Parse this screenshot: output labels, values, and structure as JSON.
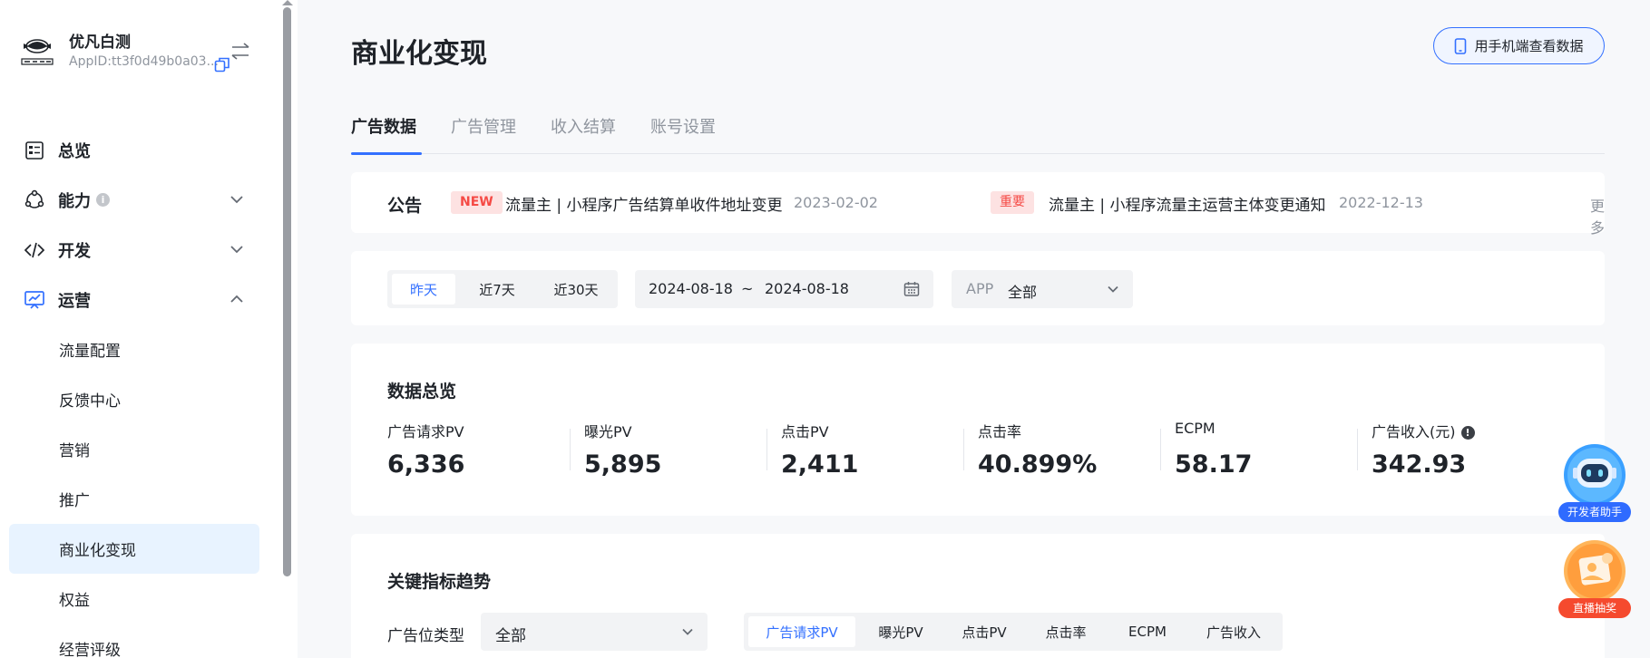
{
  "app": {
    "name": "优凡白测",
    "app_id": "AppID:tt3f0d49b0a03..."
  },
  "nav": {
    "items": [
      {
        "label": "总览",
        "icon": "overview-icon"
      },
      {
        "label": "能力",
        "icon": "ability-icon",
        "has_info": true,
        "info_glyph": "i"
      },
      {
        "label": "开发",
        "icon": "code-icon"
      },
      {
        "label": "运营",
        "icon": "operation-icon"
      }
    ],
    "sub_items": [
      {
        "label": "流量配置"
      },
      {
        "label": "反馈中心"
      },
      {
        "label": "营销"
      },
      {
        "label": "推广"
      },
      {
        "label": "商业化变现",
        "selected": true
      },
      {
        "label": "权益"
      },
      {
        "label": "经营评级"
      }
    ]
  },
  "page": {
    "title": "商业化变现",
    "mobile_button": "用手机端查看数据"
  },
  "tabs": [
    {
      "label": "广告数据",
      "active": true
    },
    {
      "label": "广告管理"
    },
    {
      "label": "收入结算"
    },
    {
      "label": "账号设置"
    }
  ],
  "notice": {
    "title": "公告",
    "items": [
      {
        "badge": "NEW",
        "text": "流量主 | 小程序广告结算单收件地址变更",
        "date": "2023-02-02"
      },
      {
        "badge": "重要",
        "text": "流量主 | 小程序流量主运营主体变更通知",
        "date": "2022-12-13"
      }
    ],
    "more": "更多"
  },
  "filter": {
    "range_options": [
      {
        "label": "昨天",
        "active": true
      },
      {
        "label": "近7天"
      },
      {
        "label": "近30天"
      }
    ],
    "date_start": "2024-08-18",
    "date_sep": "~",
    "date_end": "2024-08-18",
    "app_label": "APP",
    "app_value": "全部"
  },
  "overview": {
    "title": "数据总览",
    "metrics": [
      {
        "label": "广告请求PV",
        "value": "6,336"
      },
      {
        "label": "曝光PV",
        "value": "5,895"
      },
      {
        "label": "点击PV",
        "value": "2,411"
      },
      {
        "label": "点击率",
        "value": "40.899%"
      },
      {
        "label": "ECPM",
        "value": "58.17"
      },
      {
        "label": "广告收入(元)",
        "value": "342.93",
        "has_warn": true,
        "warn_glyph": "!"
      }
    ]
  },
  "trend": {
    "title": "关键指标趋势",
    "adtype_label": "广告位类型",
    "adtype_value": "全部",
    "metric_options": [
      {
        "label": "广告请求PV",
        "active": true
      },
      {
        "label": "曝光PV"
      },
      {
        "label": "点击PV"
      },
      {
        "label": "点击率"
      },
      {
        "label": "ECPM"
      },
      {
        "label": "广告收入"
      }
    ]
  },
  "floating": {
    "assistant_label": "开发者助手",
    "lottery_label": "直播抽奖"
  },
  "colors": {
    "accent": "#3370ff",
    "danger": "#f54a45",
    "selected_bg": "#e8f3ff"
  }
}
